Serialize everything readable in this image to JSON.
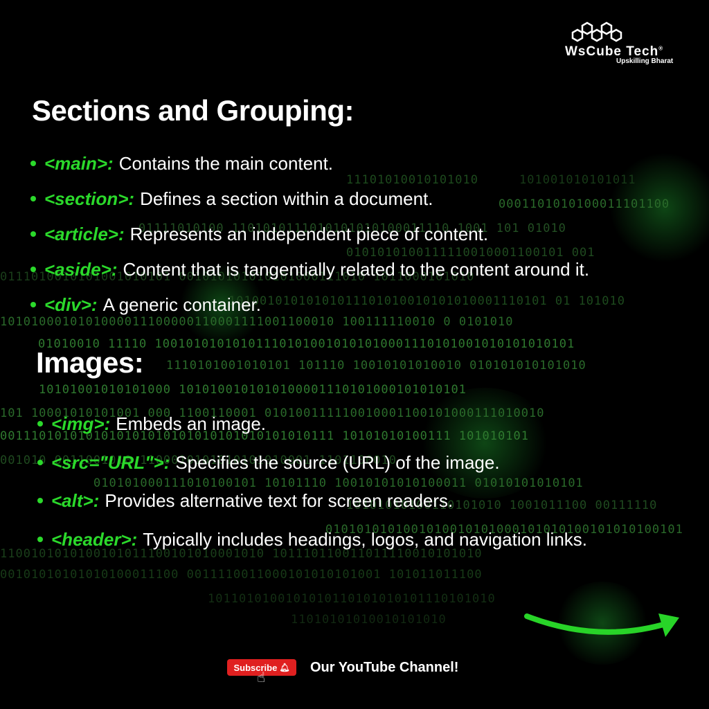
{
  "logo": {
    "name": "WsCube Tech",
    "trademark": "®",
    "tagline": "Upskilling Bharat",
    "logo_icon": "hexagon-logo-icon"
  },
  "section1": {
    "heading": "Sections and Grouping:",
    "items": [
      {
        "tag": "<main>:",
        "desc": "Contains the main content."
      },
      {
        "tag": "<section>:",
        "desc": "Defines a section within a document."
      },
      {
        "tag": "<article>:",
        "desc": "Represents an independent piece of content."
      },
      {
        "tag": "<aside>:",
        "desc": "Content that is tangentially related to the content around it."
      },
      {
        "tag": "<div>:",
        "desc": "A generic container."
      }
    ]
  },
  "section2": {
    "heading": "Images:",
    "items": [
      {
        "tag": "<img>:",
        "desc": "Embeds an image."
      },
      {
        "tag": "<src=\"URL\">:",
        "desc": "Specifies the source (URL) of the image."
      },
      {
        "tag": "<alt>:",
        "desc": "Provides alternative text for screen readers."
      },
      {
        "tag": "<header>:",
        "desc": "Typically includes headings, logos, and navigation links."
      }
    ]
  },
  "footer": {
    "subscribe_label": "Subscribe",
    "bell_icon": "bell-icon",
    "cursor_icon": "hand-pointer-icon",
    "channel_text": "Our YouTube Channel!"
  },
  "colors": {
    "background": "#000000",
    "accent": "#2bd92b",
    "subscribe": "#e02020",
    "text": "#ffffff"
  }
}
